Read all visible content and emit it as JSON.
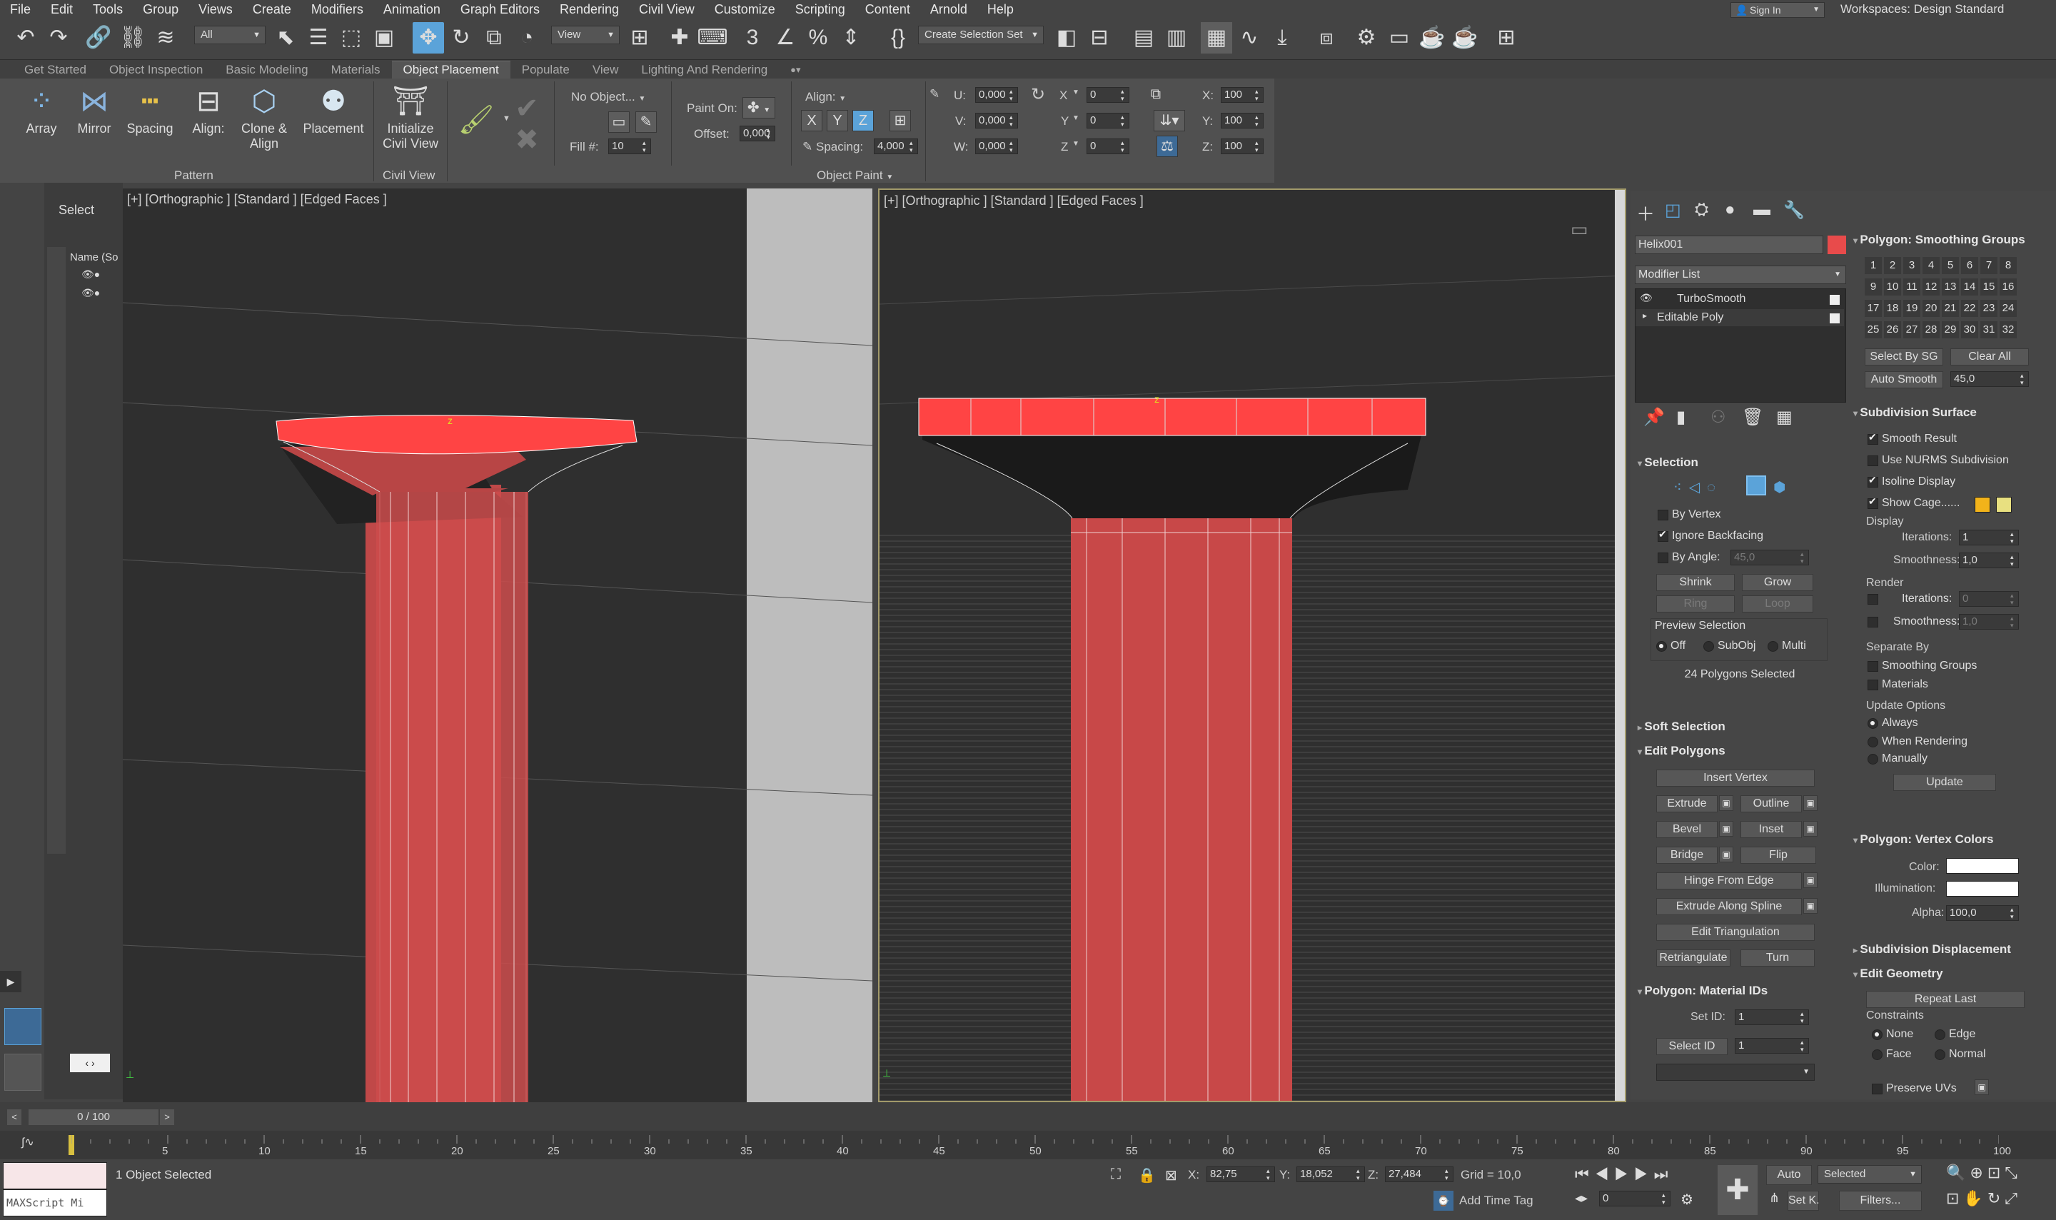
{
  "menu": [
    "File",
    "Edit",
    "Tools",
    "Group",
    "Views",
    "Create",
    "Modifiers",
    "Animation",
    "Graph Editors",
    "Rendering",
    "Civil View",
    "Customize",
    "Scripting",
    "Content",
    "Arnold",
    "Help"
  ],
  "signin": "Sign In",
  "workspace": {
    "label": "Workspaces:",
    "value": "Design Standard"
  },
  "toolbar": {
    "filter": "All",
    "view": "View",
    "selection_set": "Create Selection Set"
  },
  "tabs": [
    "Get Started",
    "Object Inspection",
    "Basic Modeling",
    "Materials",
    "Object Placement",
    "Populate",
    "View",
    "Lighting And Rendering"
  ],
  "active_tab": "Object Placement",
  "ribbon": {
    "array": "Array",
    "mirror": "Mirror",
    "spacing": "Spacing",
    "align": "Align:",
    "clone_align_1": "Clone &",
    "clone_align_2": "Align",
    "placement": "Placement",
    "pattern_group": "Pattern",
    "init_civil_1": "Initialize",
    "init_civil_2": "Civil View",
    "civil_group": "Civil View",
    "no_object": "No Object...",
    "fill_label": "Fill #:",
    "fill_value": "10",
    "paint_on": "Paint On:",
    "offset": "Offset:",
    "offset_value": "0,000",
    "spacing_label": "Spacing:",
    "spacing_value": "4,000",
    "object_paint_group": "Object Paint",
    "u_label": "U:",
    "u_value": "0,000",
    "v_label": "V:",
    "v_value": "0,000",
    "w_label": "W:",
    "w_value": "0,000",
    "x_label": "X",
    "x_value": "0",
    "y_label": "Y",
    "y_value": "0",
    "z_label": "Z",
    "z_value": "0",
    "sx_label": "X:",
    "sx_value": "100",
    "sy_label": "Y:",
    "sy_value": "100",
    "sz_label": "Z:",
    "sz_value": "100"
  },
  "scene_explorer": {
    "select": "Select",
    "name_col": "Name (So"
  },
  "viewport_left": {
    "label": "[+] [Orthographic ] [Standard ] [Edged Faces ]"
  },
  "viewport_right": {
    "label": "[+] [Orthographic ] [Standard ] [Edged Faces ]"
  },
  "modify_panel": {
    "object_name": "Helix001",
    "modifier_list": "Modifier List",
    "stack": [
      "TurboSmooth",
      "Editable Poly"
    ],
    "selection_title": "Selection",
    "by_vertex": "By Vertex",
    "ignore_backfacing": "Ignore Backfacing",
    "by_angle": "By Angle:",
    "by_angle_value": "45,0",
    "shrink": "Shrink",
    "grow": "Grow",
    "ring": "Ring",
    "loop": "Loop",
    "preview_selection": "Preview Selection",
    "off": "Off",
    "subobj": "SubObj",
    "multi": "Multi",
    "selected_count": "24 Polygons Selected",
    "soft_selection": "Soft Selection",
    "edit_polygons": "Edit Polygons",
    "insert_vertex": "Insert Vertex",
    "extrude": "Extrude",
    "outline": "Outline",
    "bevel": "Bevel",
    "inset": "Inset",
    "bridge": "Bridge",
    "flip": "Flip",
    "hinge_from_edge": "Hinge From Edge",
    "extrude_along_spline": "Extrude Along Spline",
    "edit_triangulation": "Edit Triangulation",
    "retriangulate": "Retriangulate",
    "turn": "Turn",
    "material_ids": "Polygon: Material IDs",
    "set_id": "Set ID:",
    "set_id_value": "1",
    "select_id": "Select ID",
    "select_id_value": "1"
  },
  "right_rollouts": {
    "smoothing_groups": "Polygon: Smoothing Groups",
    "sg_numbers": [
      "1",
      "2",
      "3",
      "4",
      "5",
      "6",
      "7",
      "8",
      "9",
      "10",
      "11",
      "12",
      "13",
      "14",
      "15",
      "16",
      "17",
      "18",
      "19",
      "20",
      "21",
      "22",
      "23",
      "24",
      "25",
      "26",
      "27",
      "28",
      "29",
      "30",
      "31",
      "32"
    ],
    "select_by_sg": "Select By SG",
    "clear_all": "Clear All",
    "auto_smooth": "Auto Smooth",
    "auto_smooth_value": "45,0",
    "subdivision_surface": "Subdivision Surface",
    "smooth_result": "Smooth Result",
    "use_nurms": "Use NURMS Subdivision",
    "isoline_display": "Isoline Display",
    "show_cage": "Show Cage......",
    "display": "Display",
    "iterations": "Iterations:",
    "iterations_value": "1",
    "smoothness": "Smoothness:",
    "smoothness_value": "1,0",
    "render": "Render",
    "render_iterations_value": "0",
    "render_smoothness_value": "1,0",
    "separate_by": "Separate By",
    "smoothing_groups_cb": "Smoothing Groups",
    "materials": "Materials",
    "update_options": "Update Options",
    "always": "Always",
    "when_rendering": "When Rendering",
    "manually": "Manually",
    "update": "Update",
    "vertex_colors": "Polygon: Vertex Colors",
    "color": "Color:",
    "illumination": "Illumination:",
    "alpha": "Alpha:",
    "alpha_value": "100,0",
    "subdivision_displacement": "Subdivision Displacement",
    "edit_geometry": "Edit Geometry",
    "repeat_last": "Repeat Last",
    "constraints": "Constraints",
    "none": "None",
    "edge": "Edge",
    "face": "Face",
    "normal": "Normal",
    "preserve_uvs": "Preserve UVs"
  },
  "timeline": {
    "frame": "0 / 100",
    "ticks": [
      "5",
      "10",
      "15",
      "20",
      "25",
      "30",
      "35",
      "40",
      "45",
      "50",
      "55",
      "60",
      "65",
      "70",
      "75",
      "80",
      "85",
      "90",
      "95",
      "100"
    ]
  },
  "status": {
    "maxscript": "MAXScript Mi",
    "objects_selected": "1 Object Selected",
    "x_label": "X:",
    "x": "82,75",
    "y_label": "Y:",
    "y": "18,052",
    "z_label": "Z:",
    "z": "27,484",
    "grid": "Grid = 10,0",
    "add_time_tag": "Add Time Tag",
    "auto": "Auto",
    "selected": "Selected",
    "setk": "Set K.",
    "filters": "Filters...",
    "frame_value": "0"
  },
  "colors": {
    "accent_blue": "#5ba3d9",
    "selection_red": "#ff4444",
    "object_color": "#e84b4b",
    "cage_orange": "#f2b31a",
    "cage_yellow": "#e8e080"
  }
}
